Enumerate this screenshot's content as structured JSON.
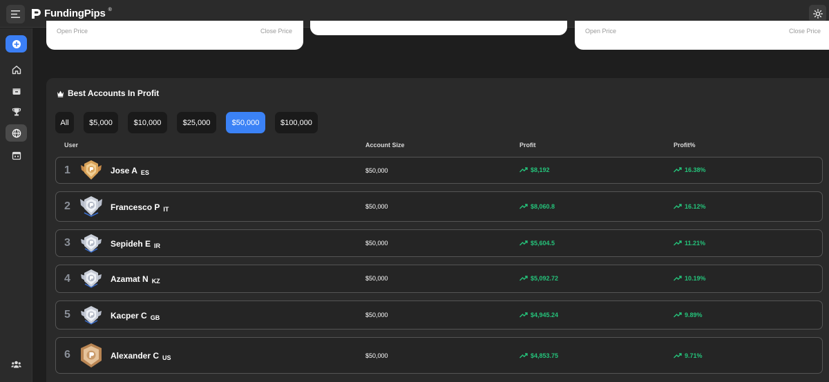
{
  "header": {
    "brand": "FundingPips",
    "brand_mark": "®"
  },
  "price_cards": [
    {
      "open_label": "Open Price",
      "close_label": "Close Price"
    },
    {
      "open_label": "",
      "close_label": ""
    },
    {
      "open_label": "Open Price",
      "close_label": "Close Price"
    }
  ],
  "leaderboard": {
    "title": "Best Accounts In Profit",
    "filters": [
      "All",
      "$5,000",
      "$10,000",
      "$25,000",
      "$50,000",
      "$100,000"
    ],
    "active_filter": "$50,000",
    "columns": {
      "user": "User",
      "account_size": "Account Size",
      "profit": "Profit",
      "profit_pct": "Profit%"
    },
    "rows": [
      {
        "rank": "1",
        "name": "Jose A",
        "country": "ES",
        "account_size": "$50,000",
        "profit": "$8,192",
        "profit_pct": "16.38%",
        "badge": "gold-badge"
      },
      {
        "rank": "2",
        "name": "Francesco P",
        "country": "IT",
        "account_size": "$50,000",
        "profit": "$8,060.8",
        "profit_pct": "16.12%",
        "badge": "silver-winged-badge"
      },
      {
        "rank": "3",
        "name": "Sepideh E",
        "country": "IR",
        "account_size": "$50,000",
        "profit": "$5,604.5",
        "profit_pct": "11.21%",
        "badge": "silver-badge"
      },
      {
        "rank": "4",
        "name": "Azamat N",
        "country": "KZ",
        "account_size": "$50,000",
        "profit": "$5,092.72",
        "profit_pct": "10.19%",
        "badge": "silver-badge"
      },
      {
        "rank": "5",
        "name": "Kacper C",
        "country": "GB",
        "account_size": "$50,000",
        "profit": "$4,945.24",
        "profit_pct": "9.89%",
        "badge": "silver-badge"
      },
      {
        "rank": "6",
        "name": "Alexander C",
        "country": "US",
        "account_size": "$50,000",
        "profit": "$4,853.75",
        "profit_pct": "9.71%",
        "badge": "bronze-badge"
      }
    ]
  },
  "colors": {
    "accent": "#3b82f6",
    "profit_green": "#25c27a",
    "gold": "#d9a35a",
    "silver": "#c9ced8",
    "bronze": "#c99a6a"
  }
}
